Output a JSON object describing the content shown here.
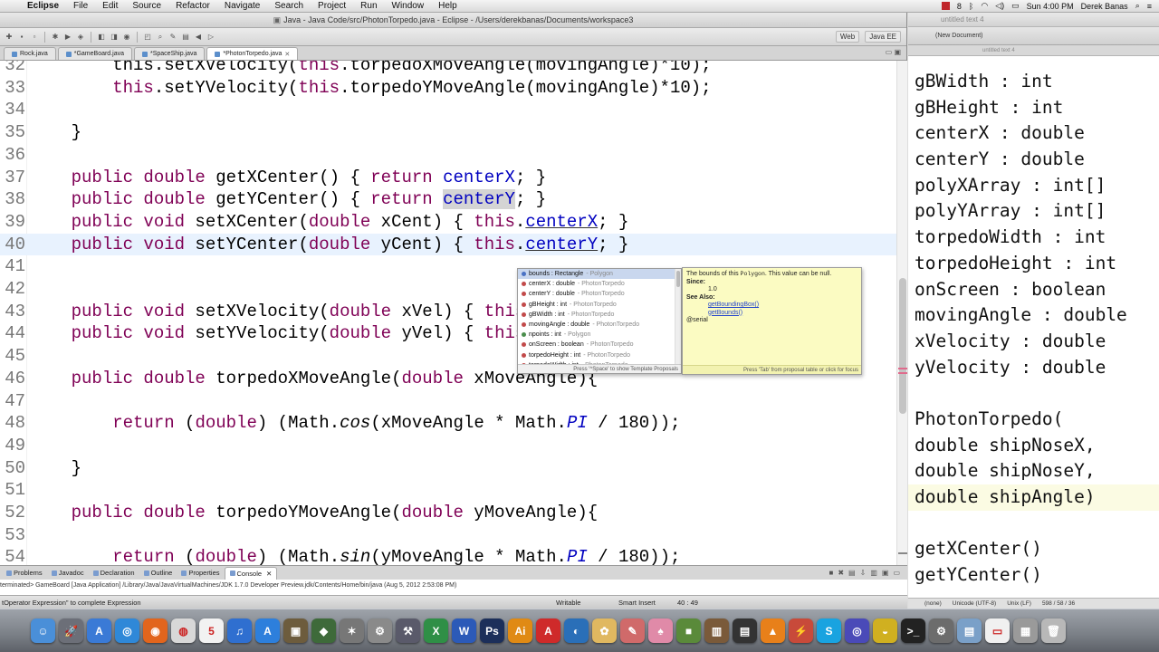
{
  "menubar": {
    "apple": "",
    "items": [
      "Eclipse",
      "File",
      "Edit",
      "Source",
      "Refactor",
      "Navigate",
      "Search",
      "Project",
      "Run",
      "Window",
      "Help"
    ],
    "clock": "Sun 4:00 PM",
    "user": "Derek Banas",
    "badge": "8"
  },
  "eclipse": {
    "title": "Java - Java Code/src/PhotonTorpedo.java - Eclipse - /Users/derekbanas/Documents/workspace3",
    "perspectives": [
      "Web",
      "Java EE"
    ],
    "tabs": [
      {
        "label": "Rock.java",
        "active": false
      },
      {
        "label": "*GameBoard.java",
        "active": false
      },
      {
        "label": "*SpaceShip.java",
        "active": false
      },
      {
        "label": "*PhotonTorpedo.java",
        "active": true
      }
    ],
    "code_lines": [
      {
        "num": "32",
        "html": "        this.setXVelocity(<span class=\"kw\">this</span>.torpedoXMoveAngle(movingAngle)*10);"
      },
      {
        "num": "33",
        "html": "        <span class=\"kw\">this</span>.setYVelocity(<span class=\"kw\">this</span>.torpedoYMoveAngle(movingAngle)*10);"
      },
      {
        "num": "34",
        "html": ""
      },
      {
        "num": "35",
        "html": "    }"
      },
      {
        "num": "36",
        "html": ""
      },
      {
        "num": "37",
        "html": "    <span class=\"kw\">public double</span> getXCenter() { <span class=\"kw\">return</span> <span class=\"fld\">centerX</span>; }"
      },
      {
        "num": "38",
        "html": "    <span class=\"kw\">public double</span> getYCenter() { <span class=\"kw\">return</span> <span class=\"fld sel\">centerY</span>; }"
      },
      {
        "num": "39",
        "html": "    <span class=\"kw\">public void</span> setXCenter(<span class=\"kw\">double</span> xCent) { <span class=\"kw\">this</span>.<span class=\"fld ul\">centerX</span>; }"
      },
      {
        "num": "40",
        "html": "    <span class=\"kw\">public void</span> setYCenter(<span class=\"kw\">double</span> yCent) { <span class=\"kw\">this</span>.<span class=\"fld ul\">centerY</span>; }"
      },
      {
        "num": "41",
        "html": ""
      },
      {
        "num": "42",
        "html": ""
      },
      {
        "num": "43",
        "html": "    <span class=\"kw\">public void</span> setXVelocity(<span class=\"kw\">double</span> xVel) { <span class=\"kw\">this</span>"
      },
      {
        "num": "44",
        "html": "    <span class=\"kw\">public void</span> setYVelocity(<span class=\"kw\">double</span> yVel) { <span class=\"kw\">this</span>"
      },
      {
        "num": "45",
        "html": ""
      },
      {
        "num": "46",
        "html": "    <span class=\"kw\">public double</span> torpedoXMoveAngle(<span class=\"kw\">double</span> xMoveAngle){"
      },
      {
        "num": "47",
        "html": ""
      },
      {
        "num": "48",
        "html": "        <span class=\"kw\">return</span> (<span class=\"kw\">double</span>) (Math.<span class=\"it\">cos</span>(xMoveAngle * Math.<span class=\"fld it\">PI</span> / 180));"
      },
      {
        "num": "49",
        "html": ""
      },
      {
        "num": "50",
        "html": "    }"
      },
      {
        "num": "51",
        "html": ""
      },
      {
        "num": "52",
        "html": "    <span class=\"kw\">public double</span> torpedoYMoveAngle(<span class=\"kw\">double</span> yMoveAngle){"
      },
      {
        "num": "53",
        "html": ""
      },
      {
        "num": "54",
        "html": "        <span class=\"kw\">return</span> (<span class=\"kw\">double</span>) (Math.<span class=\"it\">sin</span>(yMoveAngle * Math.<span class=\"fld it\">PI</span> / 180));"
      }
    ],
    "assist": {
      "items": [
        {
          "name": "bounds : Rectangle",
          "owner": " - Polygon",
          "dot": "blue",
          "selected": true
        },
        {
          "name": "centerX : double",
          "owner": " - PhotonTorpedo",
          "dot": "red"
        },
        {
          "name": "centerY : double",
          "owner": " - PhotonTorpedo",
          "dot": "red"
        },
        {
          "name": "gBHeight : int",
          "owner": " - PhotonTorpedo",
          "dot": "red"
        },
        {
          "name": "gBWidth : int",
          "owner": " - PhotonTorpedo",
          "dot": "red"
        },
        {
          "name": "movingAngle : double",
          "owner": " - PhotonTorpedo",
          "dot": "red"
        },
        {
          "name": "npoints : int",
          "owner": " - Polygon",
          "dot": "green"
        },
        {
          "name": "onScreen : boolean",
          "owner": " - PhotonTorpedo",
          "dot": "red"
        },
        {
          "name": "torpedoHeight : int",
          "owner": " - PhotonTorpedo",
          "dot": "red"
        },
        {
          "name": "torpedoWidth : int",
          "owner": " - PhotonTorpedo",
          "dot": "red"
        }
      ],
      "footer": "Press '^Space' to show Template Proposals"
    },
    "javadoc": {
      "line1_pre": "The bounds of this ",
      "line1_code": "Polygon",
      "line1_post": ". This value can be null.",
      "since_label": "Since:",
      "since_value": "1.0",
      "see_label": "See Also:",
      "links": [
        "getBoundingBox()",
        "getBounds()"
      ],
      "serial": "@serial",
      "footer": "Press 'Tab' from proposal table or click for focus"
    },
    "bottom_tabs": [
      "Problems",
      "Javadoc",
      "Declaration",
      "Outline",
      "Properties",
      "Console"
    ],
    "console_line": "terminated> GameBoard [Java Application] /Library/Java/JavaVirtualMachines/JDK 1.7.0 Developer Preview.jdk/Contents/Home/bin/java (Aug 5, 2012 2:53:08 PM)",
    "status": {
      "hint": "tOperator Expression\" to complete Expression",
      "writable": "Writable",
      "insert": "Smart Insert",
      "position": "40 : 49"
    }
  },
  "rightwin": {
    "title": "untitled text 4",
    "toolbar": "(New Document)",
    "tab": "untitled text 4",
    "lines": [
      "gBWidth : int",
      "gBHeight : int",
      "centerX : double",
      "centerY : double",
      "polyXArray : int[]",
      "polyYArray : int[]",
      "torpedoWidth : int",
      "torpedoHeight : int",
      "onScreen : boolean",
      "movingAngle : double",
      "xVelocity : double",
      "yVelocity : double",
      "",
      "PhotonTorpedo(",
      "double shipNoseX,",
      "double shipNoseY,",
      "double shipAngle)",
      "",
      "getXCenter()",
      "getYCenter()"
    ],
    "status": [
      "(none)",
      "Unicode (UTF-8)",
      "Unix (LF)",
      "598 / 58 / 36"
    ]
  },
  "dock": {
    "icons": [
      {
        "name": "finder-icon",
        "bg": "#4a8fd8",
        "glyph": "☺"
      },
      {
        "name": "launchpad-icon",
        "bg": "#6c6f78",
        "glyph": "🚀"
      },
      {
        "name": "app-store-icon",
        "bg": "#3a7ad6",
        "glyph": "A"
      },
      {
        "name": "safari-icon",
        "bg": "#2f88d8",
        "glyph": "◎"
      },
      {
        "name": "firefox-icon",
        "bg": "#e2651d",
        "glyph": "◉"
      },
      {
        "name": "chrome-icon",
        "bg": "#d8d8d8",
        "glyph": "◍"
      },
      {
        "name": "calendar-icon",
        "bg": "#f2f2f2",
        "glyph": "5"
      },
      {
        "name": "itunes-icon",
        "bg": "#2f6fd0",
        "glyph": "♫"
      },
      {
        "name": "app-store2-icon",
        "bg": "#2d7fdc",
        "glyph": "A"
      },
      {
        "name": "photo-icon",
        "bg": "#6d5c3d",
        "glyph": "▣"
      },
      {
        "name": "terminal-game-icon",
        "bg": "#3e6a3a",
        "glyph": "◆"
      },
      {
        "name": "tools-icon",
        "bg": "#777",
        "glyph": "✶"
      },
      {
        "name": "preferences-icon",
        "bg": "#8a8a8a",
        "glyph": "⚙"
      },
      {
        "name": "xcode-icon",
        "bg": "#5a5a6a",
        "glyph": "⚒"
      },
      {
        "name": "excel-icon",
        "bg": "#2f8f46",
        "glyph": "X"
      },
      {
        "name": "word-icon",
        "bg": "#2c5ab8",
        "glyph": "W"
      },
      {
        "name": "photoshop-icon",
        "bg": "#1c2f5a",
        "glyph": "Ps"
      },
      {
        "name": "illustrator-icon",
        "bg": "#e08a14",
        "glyph": "Ai"
      },
      {
        "name": "acrobat-icon",
        "bg": "#cf2a2a",
        "glyph": "A"
      },
      {
        "name": "eclipse-icon",
        "bg": "#2a6fb8",
        "glyph": "◐"
      },
      {
        "name": "flower-icon",
        "bg": "#e0b860",
        "glyph": "✿"
      },
      {
        "name": "brush-icon",
        "bg": "#d06a6a",
        "glyph": "✎"
      },
      {
        "name": "pig-icon",
        "bg": "#e08aa8",
        "glyph": "♠"
      },
      {
        "name": "minecraft-icon",
        "bg": "#5a8a3a",
        "glyph": "■"
      },
      {
        "name": "books-icon",
        "bg": "#7a5a3a",
        "glyph": "▥"
      },
      {
        "name": "clapper-icon",
        "bg": "#333",
        "glyph": "▤"
      },
      {
        "name": "vlc-icon",
        "bg": "#e8801a",
        "glyph": "▲"
      },
      {
        "name": "network-icon",
        "bg": "#c84a3a",
        "glyph": "⚡"
      },
      {
        "name": "skype-icon",
        "bg": "#19a3e0",
        "glyph": "S"
      },
      {
        "name": "globe-icon",
        "bg": "#4a4ab8",
        "glyph": "◎"
      },
      {
        "name": "tv-icon",
        "bg": "#d0b020",
        "glyph": "◒"
      },
      {
        "name": "terminal-icon",
        "bg": "#222",
        "glyph": ">_"
      },
      {
        "name": "activity-icon",
        "bg": "#6c6c6c",
        "glyph": "⚙"
      },
      {
        "name": "folder-icon",
        "bg": "#7aa0c8",
        "glyph": "▤"
      },
      {
        "name": "document-icon",
        "bg": "#f0f0f0",
        "glyph": "▭"
      },
      {
        "name": "stack-icon",
        "bg": "#9a9a9a",
        "glyph": "▦"
      },
      {
        "name": "trash-icon",
        "bg": "#b8b8b8",
        "glyph": "🗑"
      }
    ]
  }
}
